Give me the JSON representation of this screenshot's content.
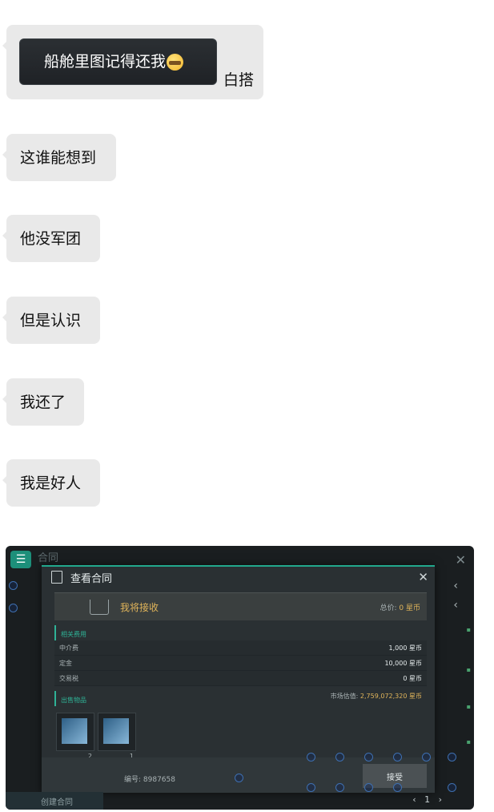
{
  "messages": [
    {
      "quote_text": "船舱里图记得还我",
      "quote_emoji": "grimace-emoji",
      "text": "白搭"
    },
    {
      "text": "这谁能想到"
    },
    {
      "text": "他没军团"
    },
    {
      "text": "但是认识"
    },
    {
      "text": "我还了"
    },
    {
      "text": "我是好人"
    }
  ],
  "screenshot": {
    "bg_title": "合同",
    "bottom_left_label": "创建合同",
    "dialog": {
      "title": "查看合同",
      "receive_label": "我将接收",
      "total_label": "总价:",
      "total_value": "0 星币",
      "fees_title": "相关费用",
      "fees": [
        {
          "label": "中介费",
          "value": "1,000 星币"
        },
        {
          "label": "定金",
          "value": "10,000 星币"
        },
        {
          "label": "交易税",
          "value": "0 星币"
        }
      ],
      "sale_title": "出售物品",
      "market_label": "市场估值:",
      "market_value": "2,759,072,320 星币",
      "items": [
        {
          "count": "2"
        },
        {
          "count": "1"
        }
      ],
      "contract_no": "编号: 8987658",
      "accept_label": "接受"
    }
  }
}
